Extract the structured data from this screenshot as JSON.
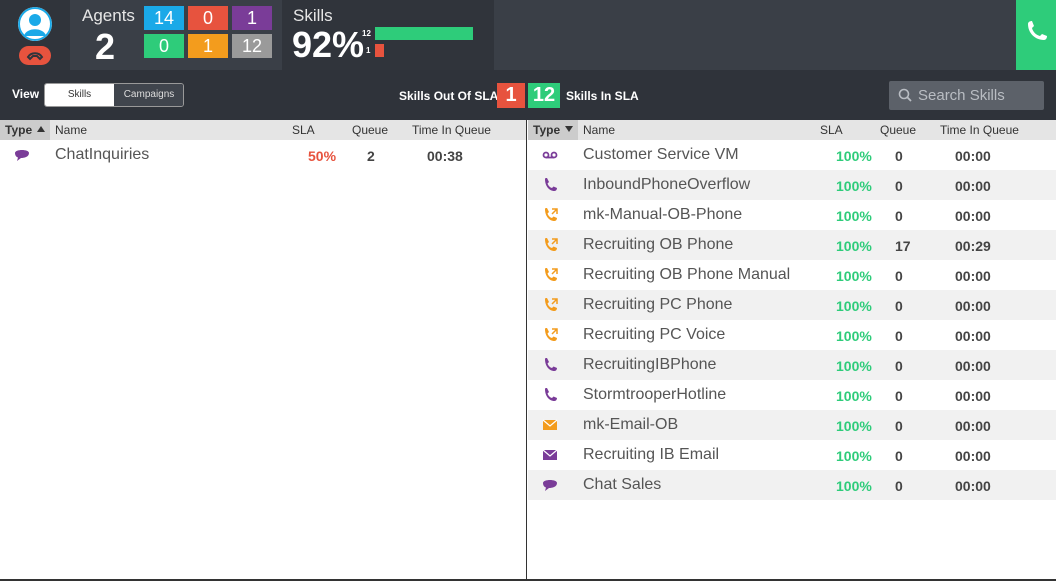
{
  "agents": {
    "label": "Agents",
    "count": "2",
    "stats": [
      {
        "value": "14",
        "color": "#1aa9e8"
      },
      {
        "value": "0",
        "color": "#e7533e"
      },
      {
        "value": "1",
        "color": "#7a3c98"
      },
      {
        "value": "0",
        "color": "#2ecc7a"
      },
      {
        "value": "1",
        "color": "#f39c1d"
      },
      {
        "value": "12",
        "color": "#9a9a9a"
      }
    ]
  },
  "skills_summary": {
    "label": "Skills",
    "percent": "92%",
    "bars": [
      {
        "label": "12",
        "value": 12,
        "color": "#2ecc7a"
      },
      {
        "label": "1",
        "value": 1,
        "color": "#e7533e"
      }
    ]
  },
  "view": {
    "label": "View",
    "options": [
      "Skills",
      "Campaigns"
    ],
    "selected": "Skills"
  },
  "sla": {
    "out_label": "Skills Out Of SLA",
    "out_count": "1",
    "in_count": "12",
    "in_label": "Skills In SLA"
  },
  "search": {
    "placeholder": "Search Skills"
  },
  "columns": {
    "type": "Type",
    "name": "Name",
    "sla": "SLA",
    "queue": "Queue",
    "time": "Time In Queue"
  },
  "out_of_sla": [
    {
      "type": "chat",
      "name": "ChatInquiries",
      "sla": "50%",
      "queue": "2",
      "time": "00:38"
    }
  ],
  "in_sla": [
    {
      "type": "voicemail",
      "name": "Customer Service VM",
      "sla": "100%",
      "queue": "0",
      "time": "00:00"
    },
    {
      "type": "phone-inbound",
      "name": "InboundPhoneOverflow",
      "sla": "100%",
      "queue": "0",
      "time": "00:00"
    },
    {
      "type": "phone-outbound",
      "name": "mk-Manual-OB-Phone",
      "sla": "100%",
      "queue": "0",
      "time": "00:00"
    },
    {
      "type": "phone-outbound",
      "name": "Recruiting OB Phone",
      "sla": "100%",
      "queue": "17",
      "time": "00:29"
    },
    {
      "type": "phone-outbound",
      "name": "Recruiting OB Phone Manual",
      "sla": "100%",
      "queue": "0",
      "time": "00:00"
    },
    {
      "type": "phone-outbound",
      "name": "Recruiting PC Phone",
      "sla": "100%",
      "queue": "0",
      "time": "00:00"
    },
    {
      "type": "phone-outbound",
      "name": "Recruiting PC Voice",
      "sla": "100%",
      "queue": "0",
      "time": "00:00"
    },
    {
      "type": "phone-inbound",
      "name": "RecruitingIBPhone",
      "sla": "100%",
      "queue": "0",
      "time": "00:00"
    },
    {
      "type": "phone-inbound",
      "name": "StormtrooperHotline",
      "sla": "100%",
      "queue": "0",
      "time": "00:00"
    },
    {
      "type": "email-outbound",
      "name": "mk-Email-OB",
      "sla": "100%",
      "queue": "0",
      "time": "00:00"
    },
    {
      "type": "email-inbound",
      "name": "Recruiting IB Email",
      "sla": "100%",
      "queue": "0",
      "time": "00:00"
    },
    {
      "type": "chat",
      "name": "Chat Sales",
      "sla": "100%",
      "queue": "0",
      "time": "00:00"
    }
  ],
  "colors": {
    "sla_good": "#2ecc7a",
    "sla_bad": "#e7533e",
    "inbound": "#7a3c98",
    "outbound": "#f39c1d"
  }
}
